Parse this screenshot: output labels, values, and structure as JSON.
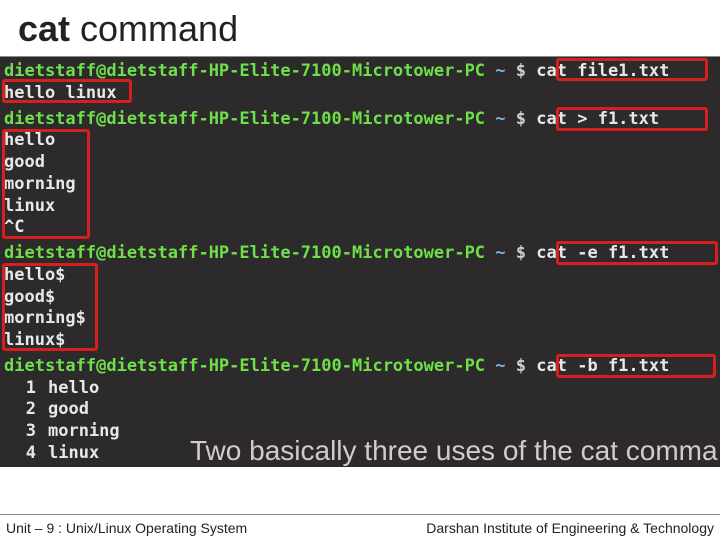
{
  "title": {
    "bold": "cat",
    "rest": " command"
  },
  "prompt": {
    "user_host": "dietstaff@dietstaff-HP-Elite-7100-Microtower-PC",
    "sep1": " ",
    "tilde": "~",
    "sep2": " ",
    "dollar": "$"
  },
  "blocks": {
    "b1": {
      "cmd": "cat file1.txt",
      "out": [
        "hello linux"
      ]
    },
    "b2": {
      "cmd": "cat > f1.txt",
      "out": [
        "hello",
        "good",
        "morning",
        "linux",
        "^C"
      ]
    },
    "b3": {
      "cmd": "cat -e f1.txt",
      "out": [
        "hello$",
        "good$",
        "morning$",
        "linux$"
      ]
    },
    "b4": {
      "cmd": "cat -b f1.txt",
      "out": [
        {
          "n": "1",
          "t": "hello"
        },
        {
          "n": "2",
          "t": "good"
        },
        {
          "n": "3",
          "t": "morning"
        },
        {
          "n": "4",
          "t": "linux"
        }
      ]
    }
  },
  "ghost": "Two basically three uses of the cat comma",
  "footer": {
    "left": "Unit – 9 : Unix/Linux Operating System",
    "right": "Darshan Institute of Engineering & Technology"
  }
}
